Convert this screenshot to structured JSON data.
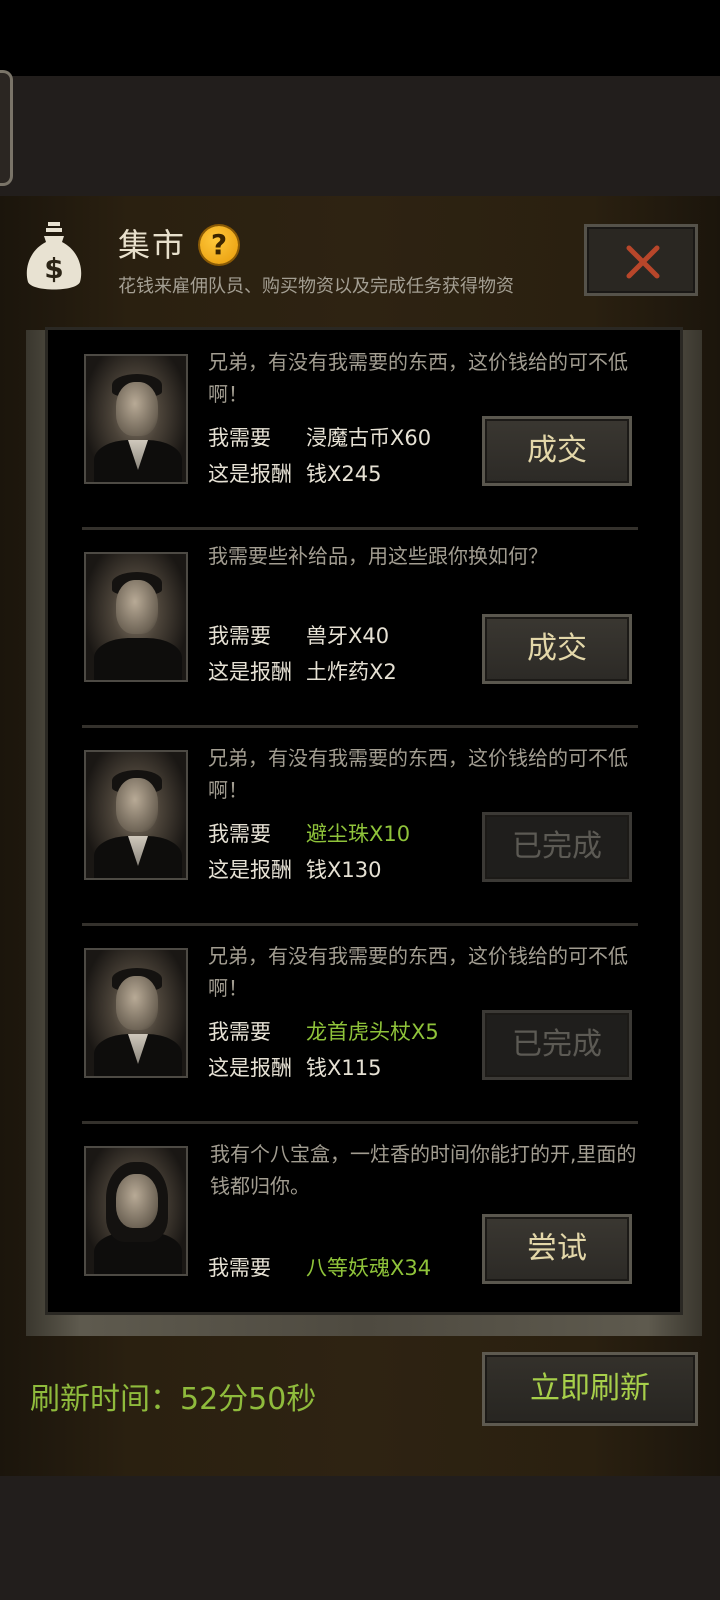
{
  "header": {
    "title": "集市",
    "help_icon": "?",
    "subtitle": "花钱来雇佣队员、购买物资以及完成任务获得物资",
    "bag_icon": "money-bag-icon",
    "close_icon": "close-x-icon"
  },
  "trades": [
    {
      "message": "兄弟，有没有我需要的东西，这价钱给的可不低啊！",
      "need_label": "我需要",
      "need_value": "浸魔古币X60",
      "reward_label": "这是报酬",
      "reward_value": "钱X245",
      "button": "成交",
      "completed": false,
      "portrait": "man-suit-portrait"
    },
    {
      "message": "我需要些补给品，用这些跟你换如何？",
      "need_label": "我需要",
      "need_value": "兽牙X40",
      "reward_label": "这是报酬",
      "reward_value": "土炸药X2",
      "button": "成交",
      "completed": false,
      "portrait": "man-rough-portrait"
    },
    {
      "message": "兄弟，有没有我需要的东西，这价钱给的可不低啊！",
      "need_label": "我需要",
      "need_value": "避尘珠X10",
      "reward_label": "这是报酬",
      "reward_value": "钱X130",
      "button": "已完成",
      "completed": true,
      "portrait": "man-suit-portrait"
    },
    {
      "message": "兄弟，有没有我需要的东西，这价钱给的可不低啊！",
      "need_label": "我需要",
      "need_value": "龙首虎头杖X5",
      "reward_label": "这是报酬",
      "reward_value": "钱X115",
      "button": "已完成",
      "completed": true,
      "portrait": "man-suit-portrait"
    },
    {
      "message": "我有个八宝盒，一炷香的时间你能打的开,里面的钱都归你。",
      "need_label": "我需要",
      "need_value": "八等妖魂X34",
      "button": "尝试",
      "completed": false,
      "portrait": "woman-portrait"
    }
  ],
  "footer": {
    "refresh_time": "刷新时间：52分50秒",
    "refresh_button": "立即刷新"
  },
  "colors": {
    "done_green": "#8fc33a",
    "button_text": "#e3d7a9",
    "help_orange": "#f5ad1f",
    "close_red": "#b8462a"
  }
}
